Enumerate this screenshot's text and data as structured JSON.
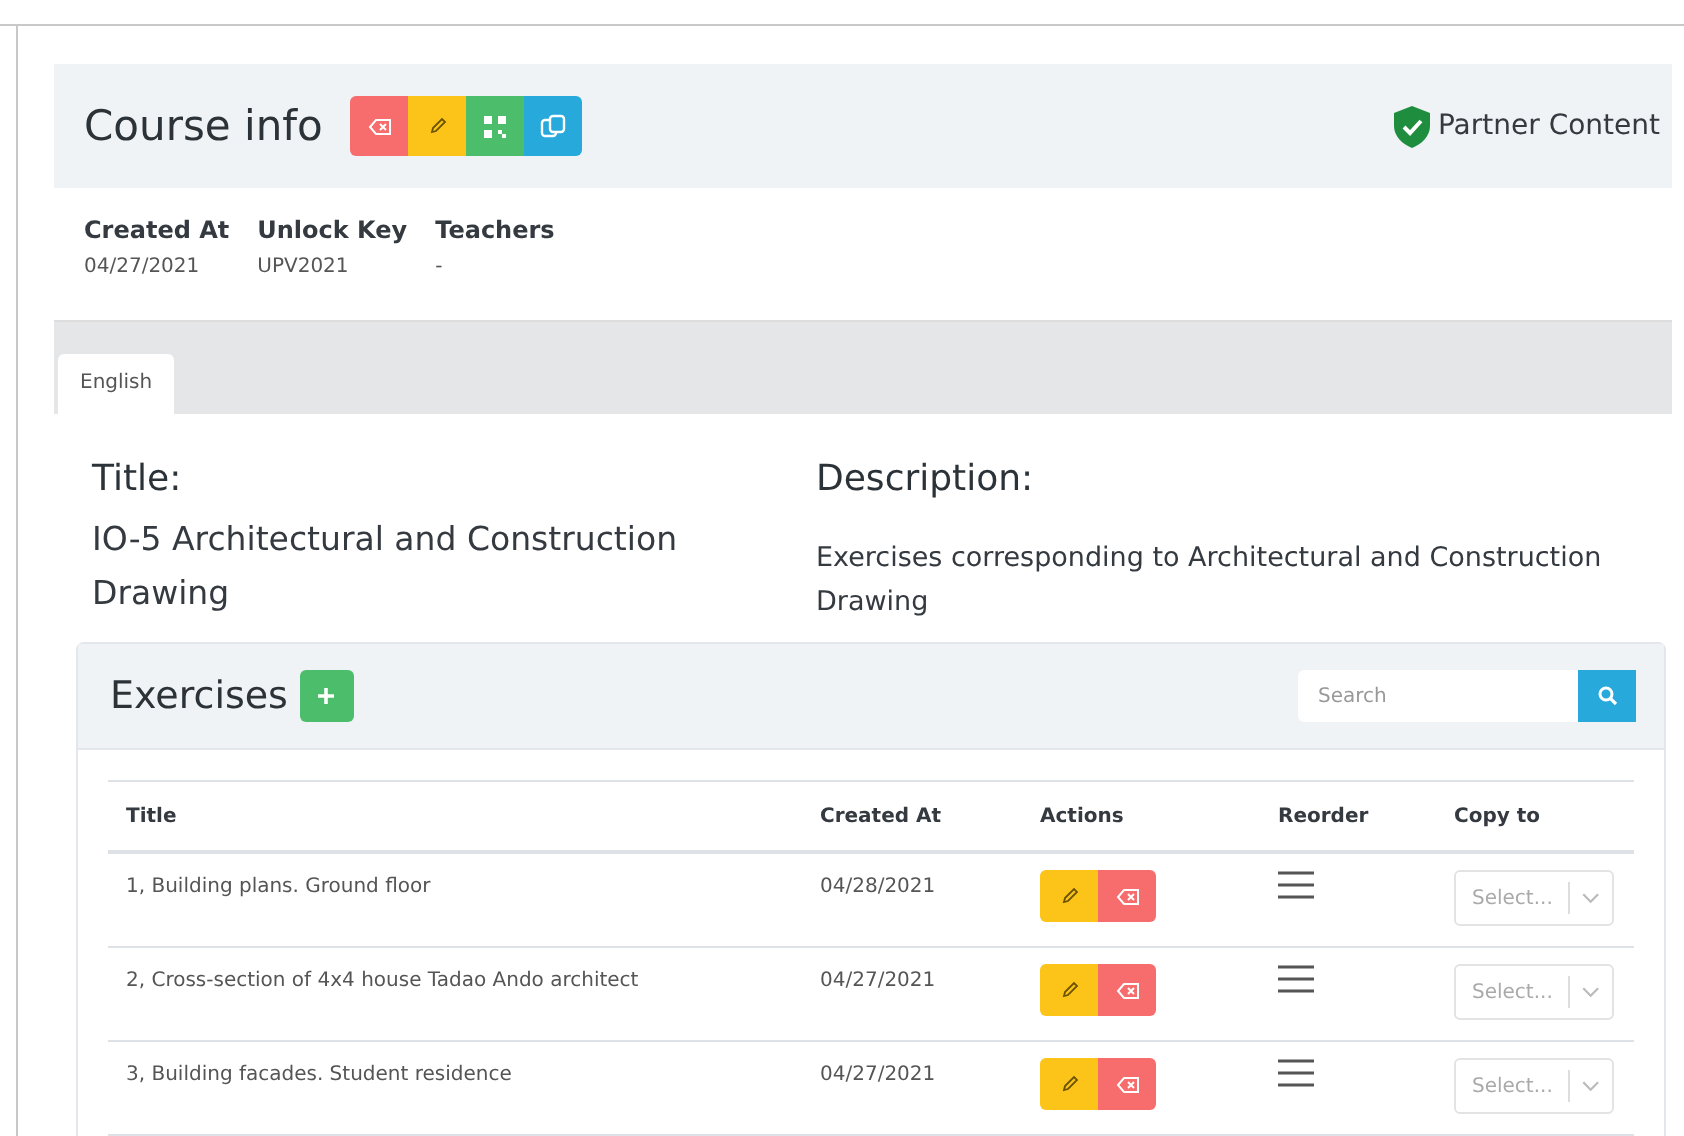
{
  "header": {
    "title": "Course info",
    "badge": "Partner Content"
  },
  "meta": [
    {
      "label": "Created At",
      "value": "04/27/2021"
    },
    {
      "label": "Unlock Key",
      "value": "UPV2021"
    },
    {
      "label": "Teachers",
      "value": "-"
    }
  ],
  "tabs": [
    {
      "label": "English",
      "selected": true
    }
  ],
  "title": {
    "label": "Title:",
    "value": "IO-5 Architectural and Construction Drawing"
  },
  "description": {
    "label": "Description:",
    "value": "Exercises corresponding to Architectural and Construction Drawing"
  },
  "exercises": {
    "title": "Exercises",
    "search": {
      "placeholder": "Search"
    },
    "columns": [
      "Title",
      "Created At",
      "Actions",
      "Reorder",
      "Copy to"
    ],
    "rows": [
      {
        "title": "1, Building plans. Ground floor",
        "created_at": "04/28/2021",
        "copy_to": "Select..."
      },
      {
        "title": "2, Cross-section of 4x4 house Tadao Ando architect",
        "created_at": "04/27/2021",
        "copy_to": "Select..."
      },
      {
        "title": "3, Building facades. Student residence",
        "created_at": "04/27/2021",
        "copy_to": "Select..."
      }
    ]
  }
}
